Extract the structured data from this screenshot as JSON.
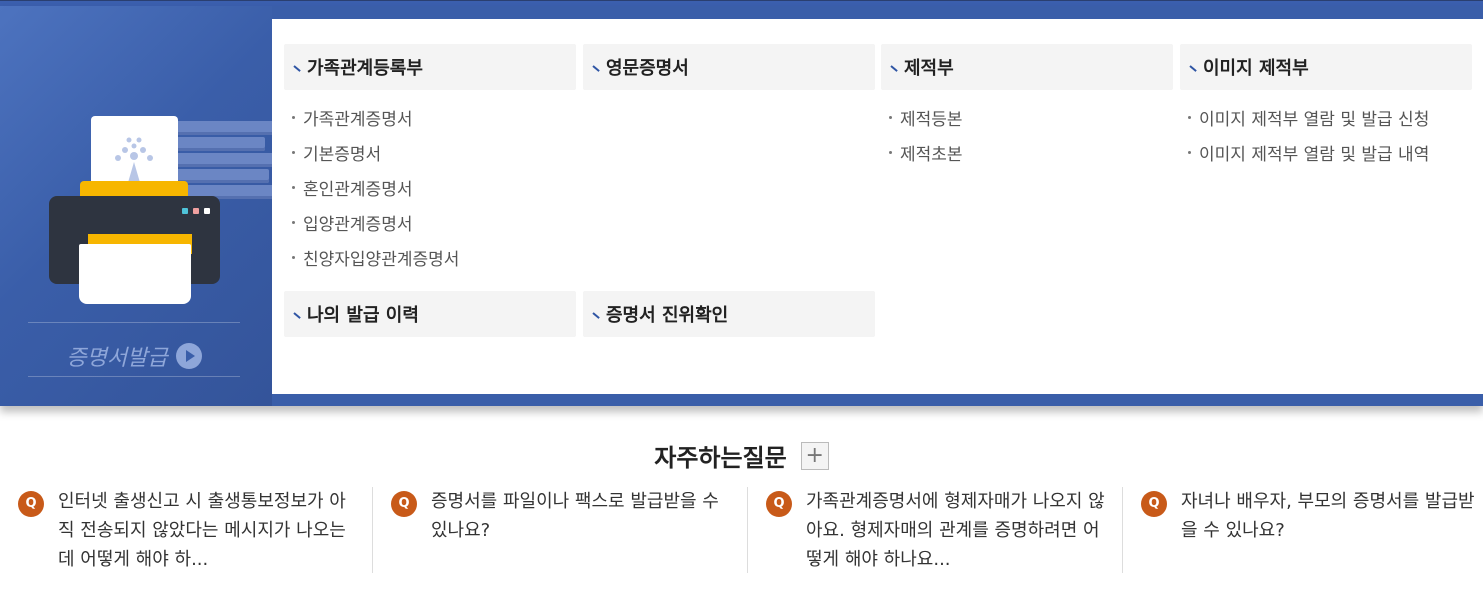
{
  "promo": {
    "label": "증명서발급",
    "colors": {
      "band": "#3a5ea9",
      "printer_body": "#2e3440",
      "printer_accent": "#f7b600"
    },
    "led_colors": [
      "#4fc3d9",
      "#f0a0a0",
      "#ffffff"
    ]
  },
  "menu": {
    "columns": [
      {
        "title": "가족관계등록부",
        "items": [
          "가족관계증명서",
          "기본증명서",
          "혼인관계증명서",
          "입양관계증명서",
          "친양자입양관계증명서"
        ]
      },
      {
        "title": "영문증명서",
        "items": []
      },
      {
        "title": "제적부",
        "items": [
          "제적등본",
          "제적초본"
        ]
      },
      {
        "title": "이미지 제적부",
        "items": [
          "이미지 제적부 열람 및 발급 신청",
          "이미지 제적부 열람 및 발급 내역"
        ]
      }
    ],
    "extra": [
      {
        "title": "나의 발급 이력"
      },
      {
        "title": "증명서 진위확인"
      }
    ]
  },
  "faq": {
    "title": "자주하는질문",
    "more_icon": "plus-icon",
    "items": [
      {
        "text": "인터넷 출생신고 시 출생통보정보가 아직 전송되지 않았다는 메시지가 나오는데 어떻게 해야 하..."
      },
      {
        "text": "증명서를 파일이나 팩스로 발급받을 수 있나요?"
      },
      {
        "text": "가족관계증명서에 형제자매가 나오지 않아요. 형제자매의 관계를 증명하려면 어떻게 해야 하나요..."
      },
      {
        "text": "자녀나 배우자, 부모의 증명서를 발급받을 수 있나요?"
      }
    ]
  }
}
